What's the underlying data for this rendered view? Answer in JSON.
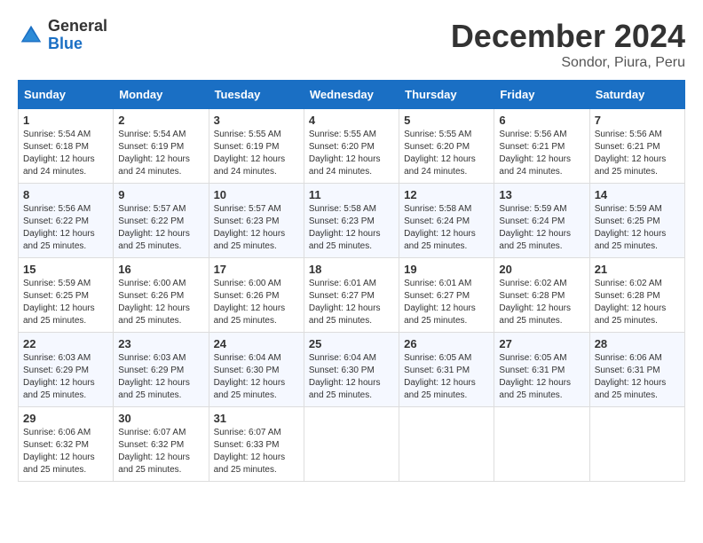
{
  "logo": {
    "general": "General",
    "blue": "Blue"
  },
  "title": "December 2024",
  "location": "Sondor, Piura, Peru",
  "headers": [
    "Sunday",
    "Monday",
    "Tuesday",
    "Wednesday",
    "Thursday",
    "Friday",
    "Saturday"
  ],
  "weeks": [
    [
      {
        "day": "1",
        "sunrise": "5:54 AM",
        "sunset": "6:18 PM",
        "daylight": "12 hours and 24 minutes."
      },
      {
        "day": "2",
        "sunrise": "5:54 AM",
        "sunset": "6:19 PM",
        "daylight": "12 hours and 24 minutes."
      },
      {
        "day": "3",
        "sunrise": "5:55 AM",
        "sunset": "6:19 PM",
        "daylight": "12 hours and 24 minutes."
      },
      {
        "day": "4",
        "sunrise": "5:55 AM",
        "sunset": "6:20 PM",
        "daylight": "12 hours and 24 minutes."
      },
      {
        "day": "5",
        "sunrise": "5:55 AM",
        "sunset": "6:20 PM",
        "daylight": "12 hours and 24 minutes."
      },
      {
        "day": "6",
        "sunrise": "5:56 AM",
        "sunset": "6:21 PM",
        "daylight": "12 hours and 24 minutes."
      },
      {
        "day": "7",
        "sunrise": "5:56 AM",
        "sunset": "6:21 PM",
        "daylight": "12 hours and 25 minutes."
      }
    ],
    [
      {
        "day": "8",
        "sunrise": "5:56 AM",
        "sunset": "6:22 PM",
        "daylight": "12 hours and 25 minutes."
      },
      {
        "day": "9",
        "sunrise": "5:57 AM",
        "sunset": "6:22 PM",
        "daylight": "12 hours and 25 minutes."
      },
      {
        "day": "10",
        "sunrise": "5:57 AM",
        "sunset": "6:23 PM",
        "daylight": "12 hours and 25 minutes."
      },
      {
        "day": "11",
        "sunrise": "5:58 AM",
        "sunset": "6:23 PM",
        "daylight": "12 hours and 25 minutes."
      },
      {
        "day": "12",
        "sunrise": "5:58 AM",
        "sunset": "6:24 PM",
        "daylight": "12 hours and 25 minutes."
      },
      {
        "day": "13",
        "sunrise": "5:59 AM",
        "sunset": "6:24 PM",
        "daylight": "12 hours and 25 minutes."
      },
      {
        "day": "14",
        "sunrise": "5:59 AM",
        "sunset": "6:25 PM",
        "daylight": "12 hours and 25 minutes."
      }
    ],
    [
      {
        "day": "15",
        "sunrise": "5:59 AM",
        "sunset": "6:25 PM",
        "daylight": "12 hours and 25 minutes."
      },
      {
        "day": "16",
        "sunrise": "6:00 AM",
        "sunset": "6:26 PM",
        "daylight": "12 hours and 25 minutes."
      },
      {
        "day": "17",
        "sunrise": "6:00 AM",
        "sunset": "6:26 PM",
        "daylight": "12 hours and 25 minutes."
      },
      {
        "day": "18",
        "sunrise": "6:01 AM",
        "sunset": "6:27 PM",
        "daylight": "12 hours and 25 minutes."
      },
      {
        "day": "19",
        "sunrise": "6:01 AM",
        "sunset": "6:27 PM",
        "daylight": "12 hours and 25 minutes."
      },
      {
        "day": "20",
        "sunrise": "6:02 AM",
        "sunset": "6:28 PM",
        "daylight": "12 hours and 25 minutes."
      },
      {
        "day": "21",
        "sunrise": "6:02 AM",
        "sunset": "6:28 PM",
        "daylight": "12 hours and 25 minutes."
      }
    ],
    [
      {
        "day": "22",
        "sunrise": "6:03 AM",
        "sunset": "6:29 PM",
        "daylight": "12 hours and 25 minutes."
      },
      {
        "day": "23",
        "sunrise": "6:03 AM",
        "sunset": "6:29 PM",
        "daylight": "12 hours and 25 minutes."
      },
      {
        "day": "24",
        "sunrise": "6:04 AM",
        "sunset": "6:30 PM",
        "daylight": "12 hours and 25 minutes."
      },
      {
        "day": "25",
        "sunrise": "6:04 AM",
        "sunset": "6:30 PM",
        "daylight": "12 hours and 25 minutes."
      },
      {
        "day": "26",
        "sunrise": "6:05 AM",
        "sunset": "6:31 PM",
        "daylight": "12 hours and 25 minutes."
      },
      {
        "day": "27",
        "sunrise": "6:05 AM",
        "sunset": "6:31 PM",
        "daylight": "12 hours and 25 minutes."
      },
      {
        "day": "28",
        "sunrise": "6:06 AM",
        "sunset": "6:31 PM",
        "daylight": "12 hours and 25 minutes."
      }
    ],
    [
      {
        "day": "29",
        "sunrise": "6:06 AM",
        "sunset": "6:32 PM",
        "daylight": "12 hours and 25 minutes."
      },
      {
        "day": "30",
        "sunrise": "6:07 AM",
        "sunset": "6:32 PM",
        "daylight": "12 hours and 25 minutes."
      },
      {
        "day": "31",
        "sunrise": "6:07 AM",
        "sunset": "6:33 PM",
        "daylight": "12 hours and 25 minutes."
      },
      null,
      null,
      null,
      null
    ]
  ]
}
